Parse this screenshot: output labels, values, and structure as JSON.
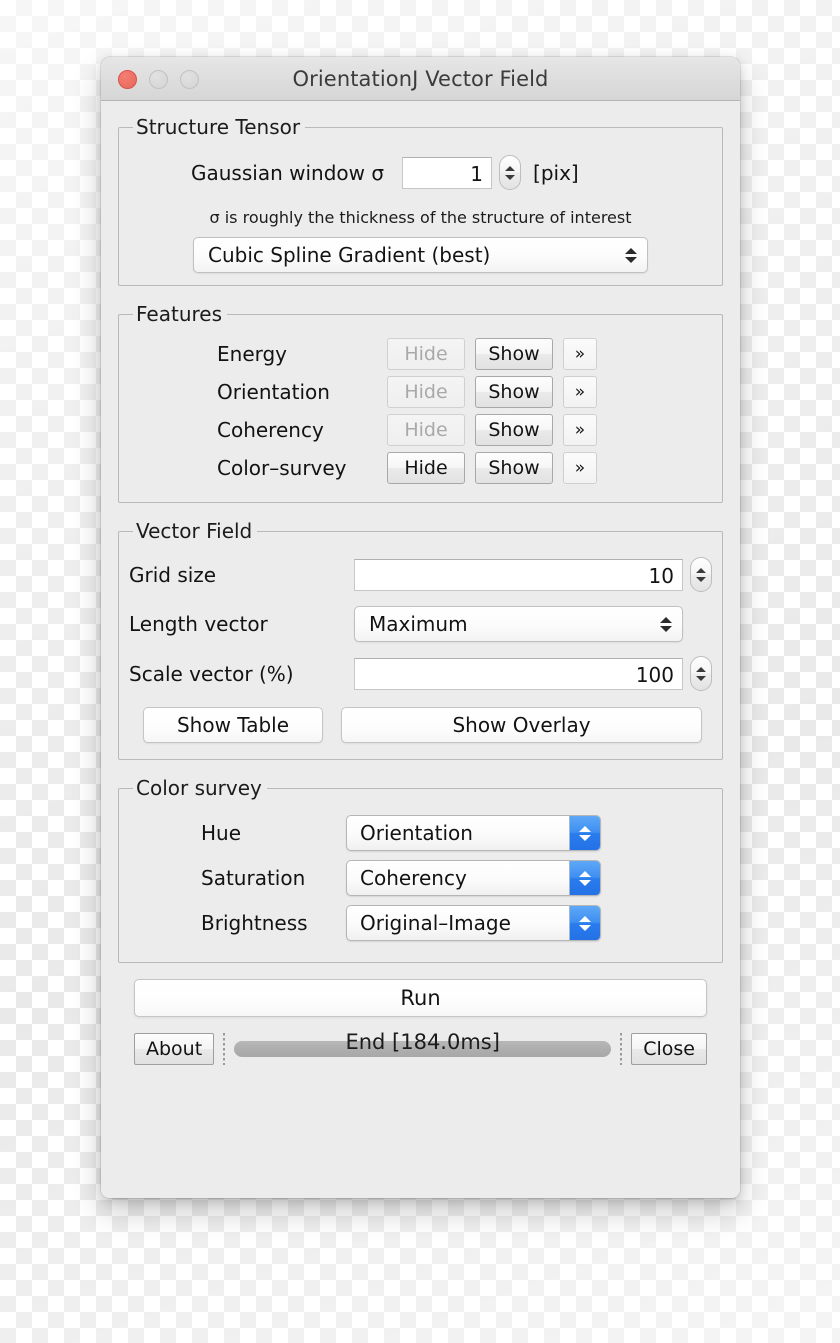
{
  "window": {
    "title": "OrientationJ Vector Field",
    "traffic_lights": [
      {
        "name": "close",
        "color": "#e8665a",
        "enabled": true
      },
      {
        "name": "minimize",
        "color": "#d3d3d3",
        "enabled": false
      },
      {
        "name": "zoom",
        "color": "#d3d3d3",
        "enabled": false
      }
    ]
  },
  "structure_tensor": {
    "legend": "Structure Tensor",
    "gaussian_label": "Gaussian window σ",
    "gaussian_value": "1",
    "gaussian_placeholder": "1",
    "unit": "[pix]",
    "hint": "σ is roughly the thickness of the structure of interest",
    "gradient_value": "Cubic Spline Gradient (best)"
  },
  "features": {
    "legend": "Features",
    "hide_label": "Hide",
    "show_label": "Show",
    "more_label": "»",
    "rows": [
      {
        "label": "Energy",
        "hide_enabled": false
      },
      {
        "label": "Orientation",
        "hide_enabled": false
      },
      {
        "label": "Coherency",
        "hide_enabled": false
      },
      {
        "label": "Color–survey",
        "hide_enabled": true
      }
    ]
  },
  "vector_field": {
    "legend": "Vector Field",
    "grid_size_label": "Grid size",
    "grid_size_value": "10",
    "length_vector_label": "Length vector",
    "length_vector_value": "Maximum",
    "scale_vector_label": "Scale vector (%)",
    "scale_vector_value": "100",
    "show_table_label": "Show Table",
    "show_overlay_label": "Show Overlay"
  },
  "color_survey": {
    "legend": "Color survey",
    "accent": "#2a7ced",
    "rows": [
      {
        "label": "Hue",
        "value": "Orientation"
      },
      {
        "label": "Saturation",
        "value": "Coherency"
      },
      {
        "label": "Brightness",
        "value": "Original–Image"
      }
    ]
  },
  "footer": {
    "run_label": "Run",
    "about_label": "About",
    "close_label": "Close",
    "status": "End [184.0ms]",
    "progress_percent": 100
  }
}
